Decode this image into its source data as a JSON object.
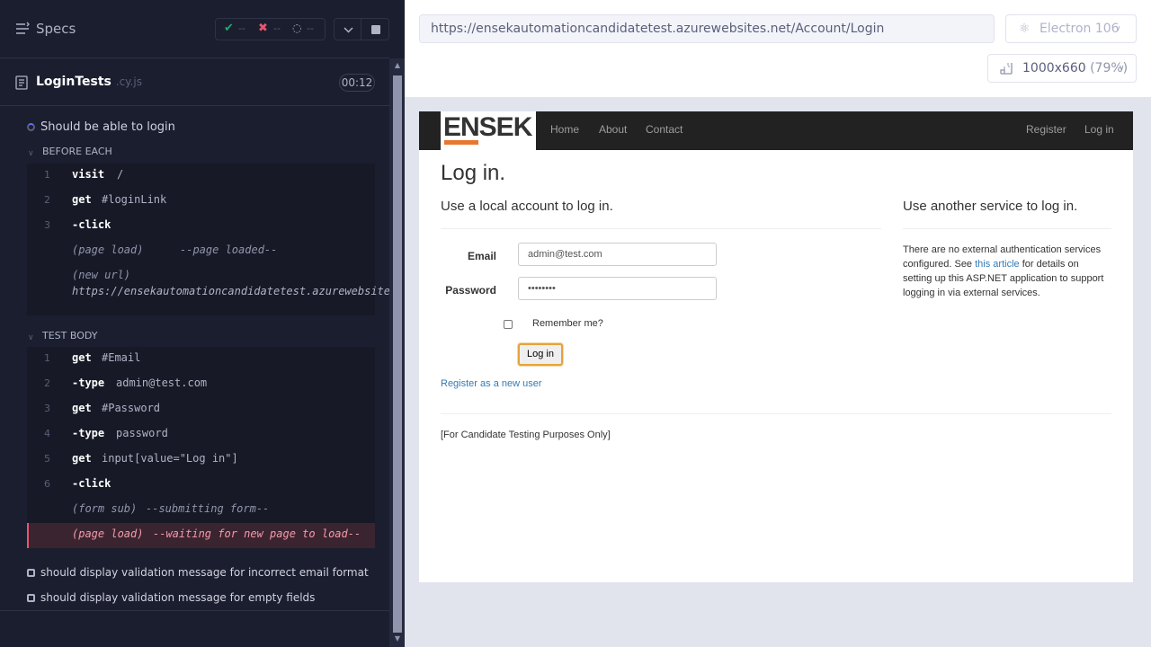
{
  "runner": {
    "specs_label": "Specs",
    "stats": {
      "passed": "--",
      "failed": "--",
      "pending": "--"
    },
    "file": {
      "name": "LoginTests",
      "ext": ".cy.js",
      "duration": "00:12"
    },
    "current_test": "Should be able to login",
    "before_each": {
      "label": "BEFORE EACH",
      "commands": [
        {
          "num": "1",
          "name": "visit",
          "msg": "/"
        },
        {
          "num": "2",
          "name": "get",
          "msg": "#loginLink"
        },
        {
          "num": "3",
          "name": "-click",
          "msg": ""
        }
      ],
      "page_load": {
        "label": "(page load)",
        "msg": "--page loaded--"
      },
      "new_url": {
        "label": "(new url)",
        "url": "https://ensekautomationcandidatetest.azurewebsites.net/Account/Login"
      }
    },
    "test_body": {
      "label": "TEST BODY",
      "commands": [
        {
          "num": "1",
          "name": "get",
          "msg": "#Email"
        },
        {
          "num": "2",
          "name": "-type",
          "msg": "admin@test.com"
        },
        {
          "num": "3",
          "name": "get",
          "msg": "#Password"
        },
        {
          "num": "4",
          "name": "-type",
          "msg": "password"
        },
        {
          "num": "5",
          "name": "get",
          "msg": "input[value=\"Log in\"]"
        },
        {
          "num": "6",
          "name": "-click",
          "msg": ""
        }
      ],
      "form_sub": {
        "label": "(form sub)",
        "msg": "--submitting form--"
      },
      "page_load": {
        "label": "(page load)",
        "msg": "--waiting for new page to load--"
      }
    },
    "other_tests": [
      "should display validation message for incorrect email format",
      "should display validation message for empty fields"
    ]
  },
  "browser": {
    "url": "https://ensekautomationcandidatetest.azurewebsites.net/Account/Login",
    "name": "Electron 106",
    "viewport": "1000x660",
    "zoom": "(79%)"
  },
  "app": {
    "logo": "ENSEK",
    "nav": {
      "home": "Home",
      "about": "About",
      "contact": "Contact",
      "register": "Register",
      "login": "Log in"
    },
    "title": "Log in.",
    "local_heading": "Use a local account to log in.",
    "other_heading": "Use another service to log in.",
    "email_label": "Email",
    "email_value": "admin@test.com",
    "password_label": "Password",
    "password_value": "••••••••",
    "remember_label": "Remember me?",
    "login_button": "Log in",
    "register_link": "Register as a new user",
    "ext_text_1": "There are no external authentication services configured. See ",
    "ext_link": "this article",
    "ext_text_2": " for details on setting up this ASP.NET application to support logging in via external services.",
    "footer": "[For Candidate Testing Purposes Only]"
  },
  "colors": {
    "runner_bg": "#1b1e2e",
    "pass": "#1fa971",
    "fail": "#e45770",
    "accent": "#e8772e",
    "link": "#337ab7"
  }
}
